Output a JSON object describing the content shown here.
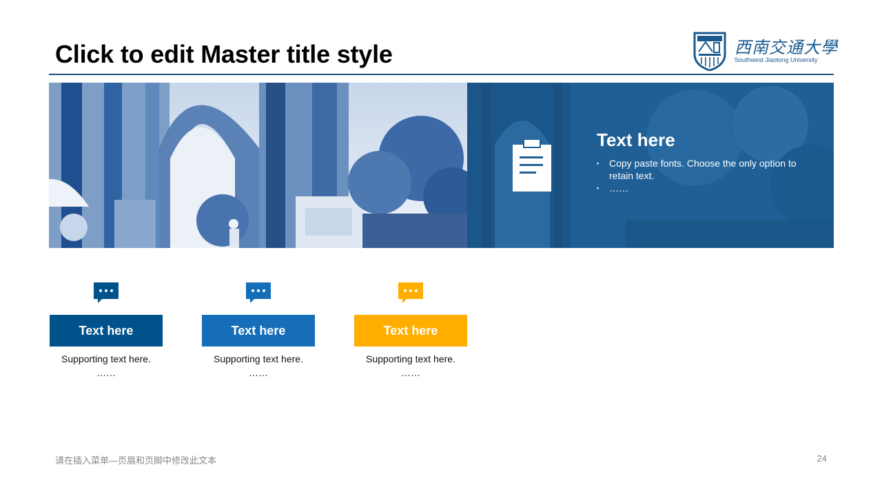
{
  "slide": {
    "title": "Click to edit Master title style",
    "footer_text": "请在插入菜单—页眉和页脚中修改此文本",
    "page_number": "24"
  },
  "logo": {
    "name_cn": "西南交通大學",
    "name_en": "Southwest Jiaotong University"
  },
  "banner": {
    "heading": "Text here",
    "bullets": [
      "Copy paste fonts. Choose the only option to retain text.",
      "……"
    ],
    "icon": "clipboard-icon"
  },
  "cards": [
    {
      "label": "Text here",
      "support": "Supporting text here.",
      "ellipsis": "……",
      "color": "#00528a",
      "icon": "chat-bubble-icon"
    },
    {
      "label": "Text here",
      "support": "Supporting text here.",
      "ellipsis": "……",
      "color": "#166db8",
      "icon": "chat-bubble-icon"
    },
    {
      "label": "Text here",
      "support": "Supporting text here.",
      "ellipsis": "……",
      "color": "#ffae00",
      "icon": "chat-bubble-icon"
    }
  ],
  "colors": {
    "primary": "#1f5f96",
    "title_rule": "#1f4e79",
    "logo_blue": "#1a5a8e"
  }
}
